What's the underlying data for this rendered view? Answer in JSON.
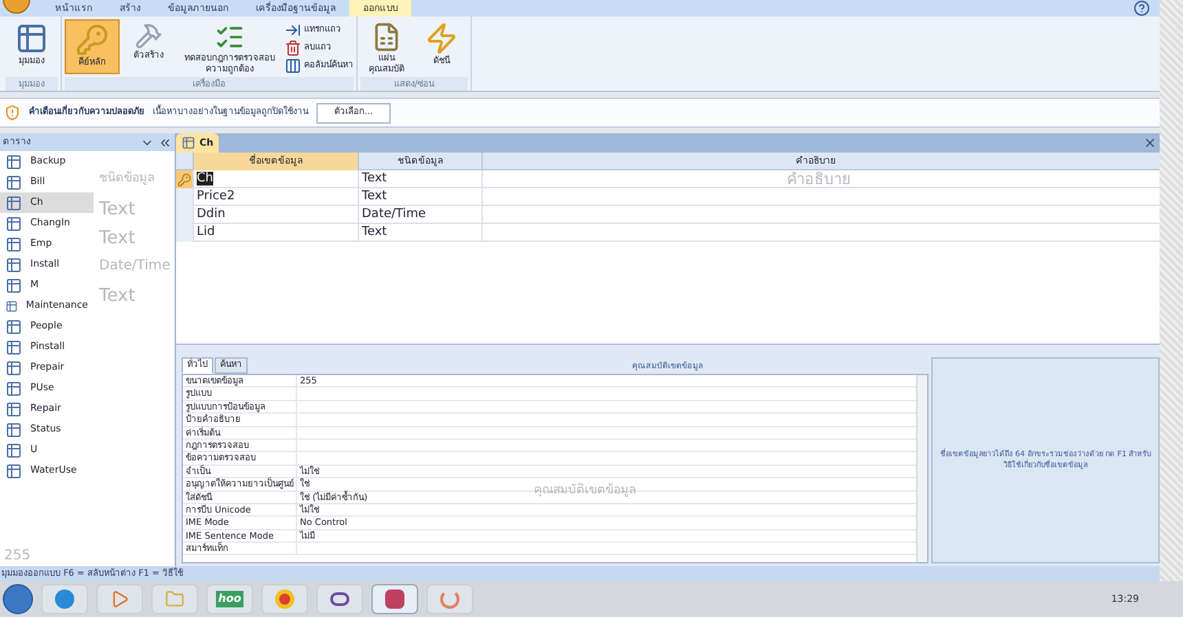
{
  "ribbon": {
    "tabs": [
      {
        "label": "หน้าแรก",
        "selected": false
      },
      {
        "label": "สร้าง",
        "selected": false
      },
      {
        "label": "ข้อมูลภายนอก",
        "selected": false
      },
      {
        "label": "เครื่องมือฐานข้อมูล",
        "selected": false
      },
      {
        "label": "ออกแบบ",
        "selected": true
      }
    ],
    "groups": [
      {
        "label": "มุมมอง",
        "buttons": [
          {
            "kind": "view",
            "label": "มุมมอง",
            "selected": false
          }
        ]
      },
      {
        "label": "เครื่องมือ",
        "buttons": [
          {
            "kind": "key",
            "label": "คีย์หลัก",
            "selected": true
          },
          {
            "kind": "builder",
            "label": "ตัวสร้าง",
            "selected": false
          },
          {
            "kind": "test",
            "label": "ทดสอบกฎการตรวจสอบความถูกต้อง",
            "selected": false
          }
        ],
        "small": [
          {
            "kind": "insert",
            "label": "แทรกแถว"
          },
          {
            "kind": "delete",
            "label": "ลบแถว"
          },
          {
            "kind": "lookup",
            "label": "คอลัมน์ค้นหา"
          }
        ]
      },
      {
        "label": "แสดง/ซ่อน",
        "buttons": [
          {
            "kind": "sheet",
            "label": "แผ่นคุณสมบัติ",
            "selected": false
          },
          {
            "kind": "index",
            "label": "ดัชนี",
            "selected": false
          }
        ]
      }
    ]
  },
  "security_bar": {
    "title": "คำเตือนเกี่ยวกับความปลอดภัย",
    "message": "เนื้อหาบางอย่างในฐานข้อมูลถูกปิดใช้งาน",
    "button": "ตัวเลือก..."
  },
  "nav_pane": {
    "title": "ตาราง",
    "items": [
      {
        "label": "Backup",
        "selected": false
      },
      {
        "label": "Bill",
        "selected": false
      },
      {
        "label": "Ch",
        "selected": true
      },
      {
        "label": "ChangIn",
        "selected": false
      },
      {
        "label": "Emp",
        "selected": false
      },
      {
        "label": "Install",
        "selected": false
      },
      {
        "label": "M",
        "selected": false
      },
      {
        "label": "Maintenance",
        "selected": false
      },
      {
        "label": "People",
        "selected": false
      },
      {
        "label": "Pinstall",
        "selected": false
      },
      {
        "label": "Prepair",
        "selected": false
      },
      {
        "label": "PUse",
        "selected": false
      },
      {
        "label": "Repair",
        "selected": false
      },
      {
        "label": "Status",
        "selected": false
      },
      {
        "label": "U",
        "selected": false
      },
      {
        "label": "WaterUse",
        "selected": false
      }
    ]
  },
  "document": {
    "tab": "Ch",
    "columns": [
      "ชื่อเขตข้อมูล",
      "ชนิดข้อมูล",
      "คำอธิบาย"
    ],
    "rows": [
      {
        "name": "Ch",
        "type": "Text",
        "primary_key": true,
        "selected": true
      },
      {
        "name": "Price2",
        "type": "Text",
        "primary_key": false,
        "selected": false
      },
      {
        "name": "Ddin",
        "type": "Date/Time",
        "primary_key": false,
        "selected": false
      },
      {
        "name": "Lid",
        "type": "Text",
        "primary_key": false,
        "selected": false
      }
    ]
  },
  "properties": {
    "title": "คุณสมบัติเขตข้อมูล",
    "tabs": [
      {
        "label": "ทั่วไป",
        "selected": true
      },
      {
        "label": "ค้นหา",
        "selected": false
      }
    ],
    "rows": [
      {
        "label": "ขนาดเขตข้อมูล",
        "value": "255"
      },
      {
        "label": "รูปแบบ"
      },
      {
        "label": "รูปแบบการป้อนข้อมูล"
      },
      {
        "label": "ป้ายคำอธิบาย"
      },
      {
        "label": "ค่าเริ่มต้น"
      },
      {
        "label": "กฎการตรวจสอบ"
      },
      {
        "label": "ข้อความตรวจสอบ"
      },
      {
        "label": "จำเป็น",
        "value": "ไม่ใช่"
      },
      {
        "label": "อนุญาตให้ความยาวเป็นศูนย์",
        "value": "ใช่"
      },
      {
        "label": "ใส่ดัชนี",
        "value": "ใช่ (ไม่มีค่าซ้ำกัน)"
      },
      {
        "label": "การบีบ Unicode",
        "value": "ไม่ใช่"
      },
      {
        "label": "IME Mode",
        "value": "No Control"
      },
      {
        "label": "IME Sentence Mode",
        "value": "ไม่มี"
      },
      {
        "label": "สมาร์ทแท็ก"
      }
    ],
    "help": "ชื่อเขตข้อมูลยาวได้ถึง 64 อักขระรวมช่องว่างด้วย กด F1 สำหรับวิธีใช้เกี่ยวกับชื่อเขตข้อมูล"
  },
  "ghost_texts": [
    "ชนิดข้อมูล",
    "Text",
    "Text",
    "Date/Time",
    "Text",
    "คำอธิบาย",
    "คุณสมบัติเขตข้อมูล",
    "255"
  ],
  "status_bar": "มุมมองออกแบบ F6 = สลับหน้าต่าง F1 = วิธีใช้",
  "taskbar": {
    "clock": "13:29",
    "apps": [
      {
        "kind": "start"
      },
      {
        "kind": "browser"
      },
      {
        "kind": "media"
      },
      {
        "kind": "folder"
      },
      {
        "kind": "hoo",
        "label": "hoo"
      },
      {
        "kind": "chrome"
      },
      {
        "kind": "vs"
      },
      {
        "kind": "access",
        "selected": true
      },
      {
        "kind": "loader"
      }
    ]
  }
}
